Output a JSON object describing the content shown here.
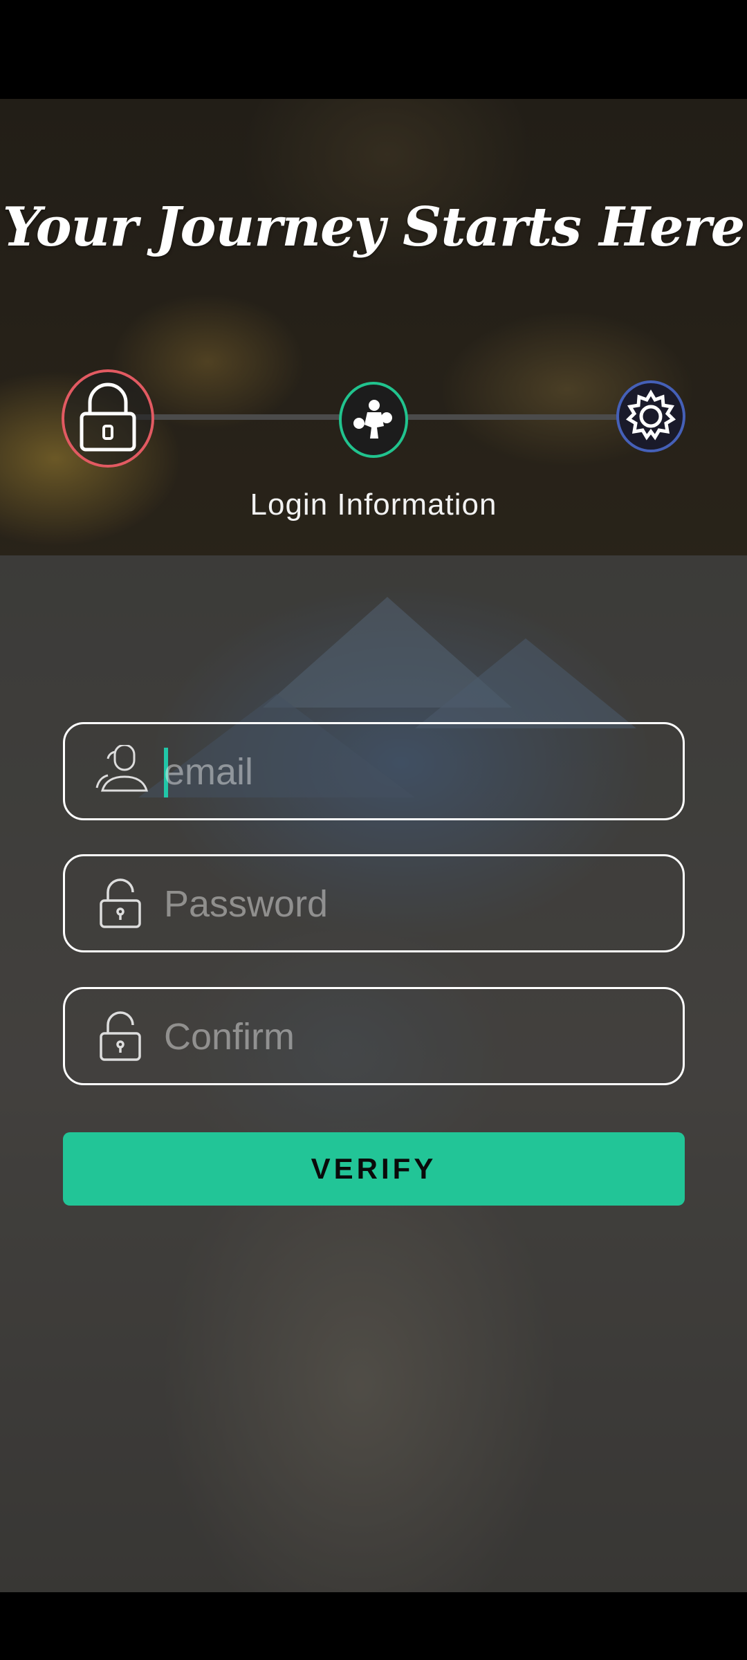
{
  "app": {
    "title": "Your Journey Starts Here"
  },
  "steps": {
    "items": [
      {
        "id": "login",
        "icon": "lock-icon",
        "color": "#e25a62",
        "active": true
      },
      {
        "id": "profile",
        "icon": "boxer-icon",
        "color": "#21c38e",
        "active": false
      },
      {
        "id": "settings",
        "icon": "gear-icon",
        "color": "#4560b8",
        "active": false
      }
    ],
    "current_label": "Login Information"
  },
  "form": {
    "email": {
      "placeholder": "email",
      "value": "",
      "icon": "user-icon"
    },
    "password": {
      "placeholder": "Password",
      "value": "",
      "icon": "unlock-icon"
    },
    "confirm": {
      "placeholder": "Confirm",
      "value": "",
      "icon": "unlock-icon"
    },
    "submit_label": "VERIFY"
  },
  "colors": {
    "accent": "#22c597",
    "step_login": "#e25a62",
    "step_profile": "#21c38e",
    "step_settings": "#4560b8"
  }
}
